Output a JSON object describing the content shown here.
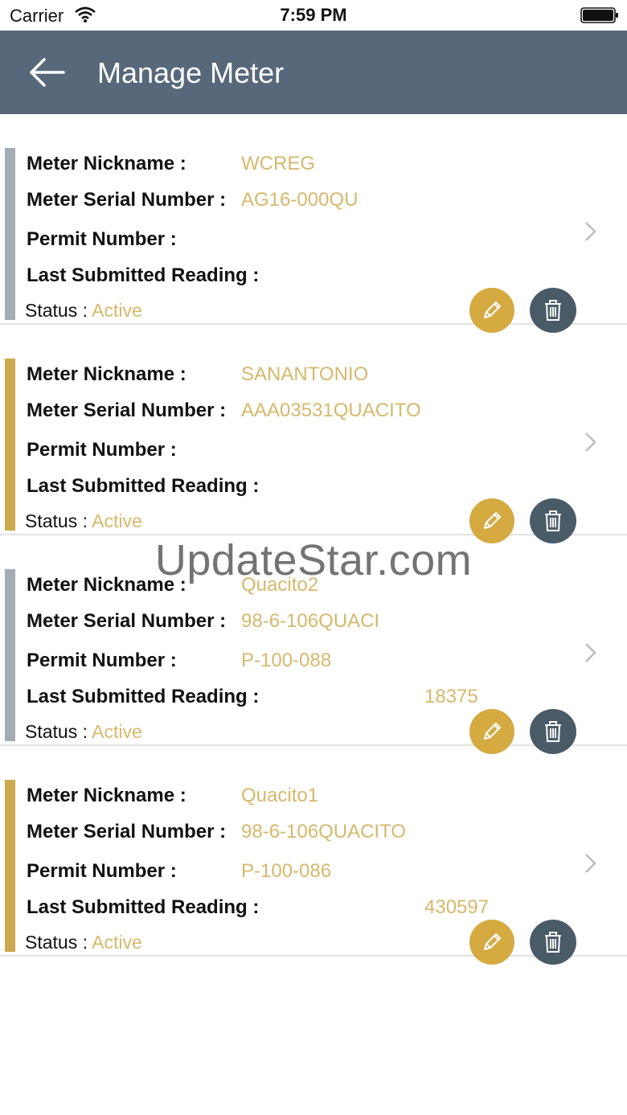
{
  "status_bar": {
    "carrier": "Carrier",
    "time": "7:59 PM"
  },
  "header": {
    "title": "Manage Meter",
    "back_icon": "arrow-left-icon"
  },
  "labels": {
    "nickname": "Meter Nickname :",
    "serial": "Meter Serial Number :",
    "permit": "Permit Number :",
    "reading": "Last Submitted  Reading :",
    "status": "Status :"
  },
  "meters": [
    {
      "nickname": "WCREG",
      "serial": "AG16-000QU",
      "permit": "",
      "last_reading": "",
      "status": "Active",
      "accent": "#a3acb3"
    },
    {
      "nickname": "SANANTONIO",
      "serial": "AAA03531QUACITO",
      "permit": "",
      "last_reading": "",
      "status": "Active",
      "accent": "#cda94d"
    },
    {
      "nickname": "Quacito2",
      "serial": "98-6-106QUACI",
      "permit": "P-100-088",
      "last_reading": "18375",
      "status": "Active",
      "accent": "#a3acb3"
    },
    {
      "nickname": "Quacito1",
      "serial": "98-6-106QUACITO",
      "permit": "P-100-086",
      "last_reading": "430597",
      "status": "Active",
      "accent": "#cda94d"
    }
  ],
  "watermark": "UpdateStar.com",
  "colors": {
    "nav": "#56687a",
    "gold": "#d4aa41",
    "value_text": "#d6b86b",
    "delete": "#4a5b68"
  }
}
